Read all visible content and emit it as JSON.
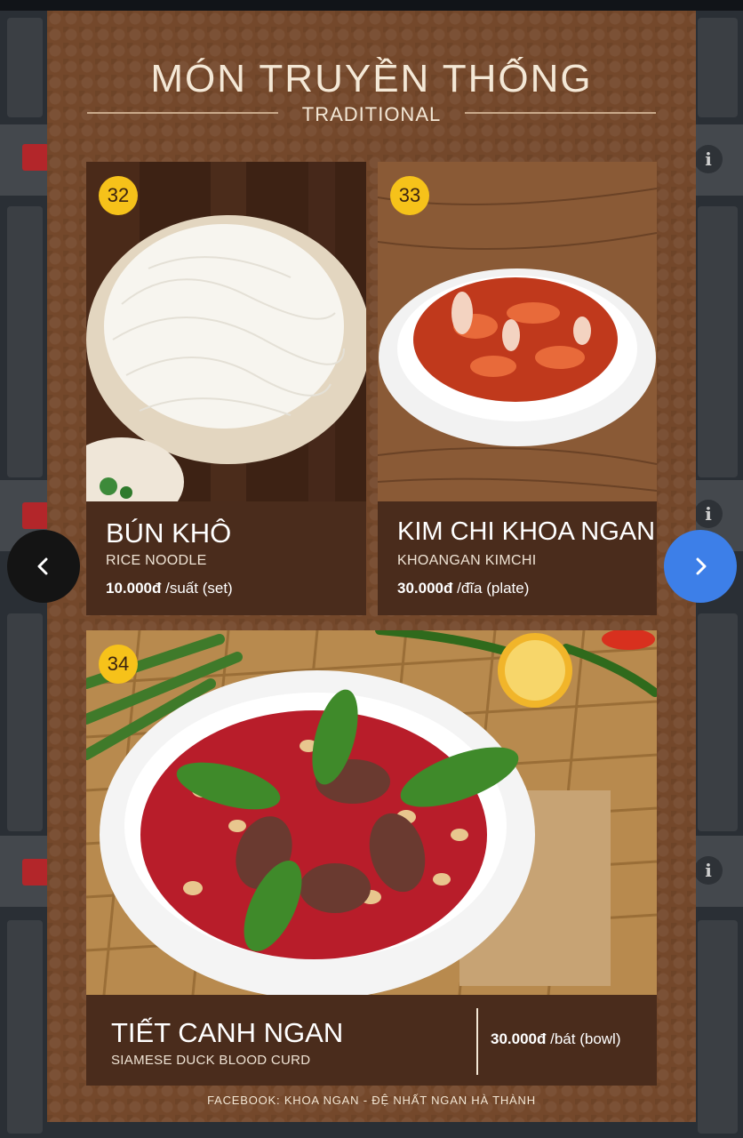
{
  "poster": {
    "title_vi": "MÓN TRUYỀN THỐNG",
    "title_en": "TRADITIONAL",
    "footer": "FACEBOOK: KHOA NGAN - ĐỆ NHẤT NGAN HÀ THÀNH"
  },
  "items": [
    {
      "number": "32",
      "name": "BÚN KHÔ",
      "subtitle": "RICE NOODLE",
      "price": "10.000đ",
      "unit": "/suất (set)"
    },
    {
      "number": "33",
      "name": "KIM CHI KHOA NGAN",
      "subtitle": "KHOANGAN KIMCHI",
      "price": "30.000đ",
      "unit": "/đĩa (plate)"
    },
    {
      "number": "34",
      "name": "TIẾT CANH NGAN",
      "subtitle": "SIAMESE DUCK BLOOD CURD",
      "price": "30.000đ",
      "unit": "/bát (bowl)"
    }
  ],
  "navigation": {
    "prev_icon": "chevron-left-icon",
    "next_icon": "chevron-right-icon"
  },
  "colors": {
    "poster": "#74482b",
    "panel": "#4a2c1c",
    "badge": "#f6c21a",
    "next_button": "#3d7fe8"
  }
}
